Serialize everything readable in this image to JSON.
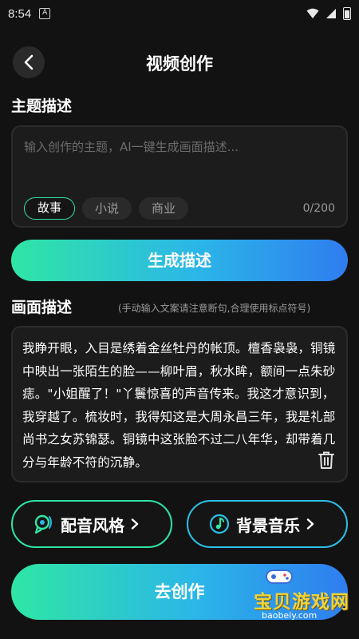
{
  "status_bar": {
    "time": "8:54",
    "notif_letter": "A"
  },
  "header": {
    "title": "视频创作"
  },
  "topic": {
    "heading": "主题描述",
    "placeholder": "输入创作的主题，AI一键生成画面描述...",
    "chips": [
      "故事",
      "小说",
      "商业"
    ],
    "active_chip": "故事",
    "counter": "0/200"
  },
  "generate_button": "生成描述",
  "scene": {
    "heading": "画面描述",
    "hint": "(手动输入文案请注意断句,合理使用标点符号)",
    "text": "我睁开眼，入目是绣着金丝牡丹的帐顶。檀香袅袅，铜镜中映出一张陌生的脸——柳叶眉，秋水眸，额间一点朱砂痣。\"小姐醒了！\"丫鬟惊喜的声音传来。我这才意识到，我穿越了。梳妆时，我得知这是大周永昌三年，我是礼部尚书之女苏锦瑟。铜镜中这张脸不过二八年华，却带着几分与年龄不符的沉静。"
  },
  "options": {
    "voice_style": "配音风格",
    "bg_music": "背景音乐"
  },
  "go_button": "去创作",
  "watermark": {
    "text": "宝贝游戏网",
    "url": "baobeiy.com"
  },
  "colors": {
    "accent_green": "#2fe6a4",
    "accent_blue": "#2f7df0",
    "background": "#121212"
  }
}
